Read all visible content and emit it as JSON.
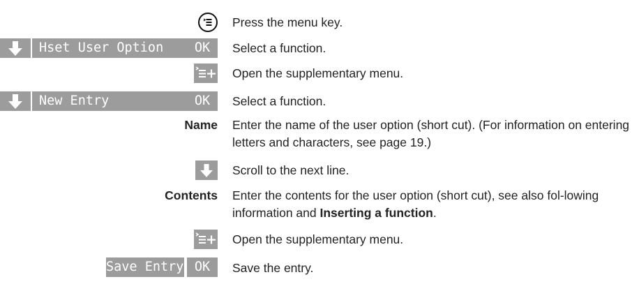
{
  "steps": [
    {
      "text": "Press the menu key.",
      "icon": "menu-key-icon"
    },
    {
      "display": "Hset User Option",
      "ok": "OK",
      "text": "Select a function."
    },
    {
      "text": "Open the supplementary menu.",
      "icon": "supplementary-menu-icon"
    },
    {
      "display": "New Entry",
      "ok": "OK",
      "text": "Select a function."
    },
    {
      "label": "Name",
      "text": "Enter the name of the user option (short cut). (For information on entering letters and characters, see page 19.)"
    },
    {
      "text": "Scroll to the next line.",
      "icon": "arrow-down-icon"
    },
    {
      "label": "Contents",
      "text_before": "Enter the contents for the user option (short cut), see also fol-lowing information and ",
      "text_bold": "Inserting a function",
      "text_after": "."
    },
    {
      "text": "Open the supplementary menu.",
      "icon": "supplementary-menu-icon"
    },
    {
      "display": "Save Entry",
      "ok": "OK",
      "text": "Save the entry."
    }
  ],
  "colors": {
    "display_bg": "#9c9c9c",
    "display_text": "#ffffff"
  }
}
